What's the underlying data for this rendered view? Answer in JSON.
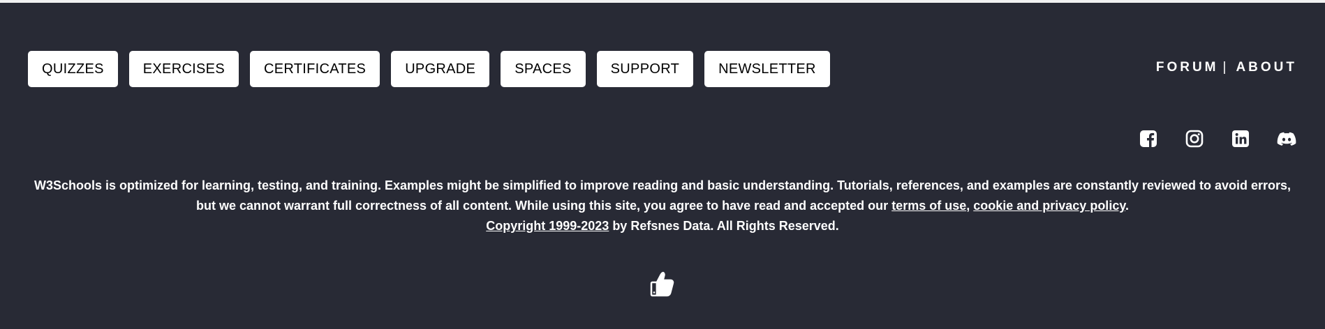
{
  "nav": {
    "buttons": [
      "QUIZZES",
      "EXERCISES",
      "CERTIFICATES",
      "UPGRADE",
      "SPACES",
      "SUPPORT",
      "NEWSLETTER"
    ]
  },
  "top_links": {
    "forum": "FORUM",
    "separator": "|",
    "about": "ABOUT"
  },
  "social": {
    "icons": [
      "facebook-icon",
      "instagram-icon",
      "linkedin-icon",
      "discord-icon"
    ]
  },
  "footer": {
    "text_before_links": "W3Schools is optimized for learning, testing, and training. Examples might be simplified to improve reading and basic understanding. Tutorials, references, and examples are constantly reviewed to avoid errors, but we cannot warrant full correctness of all content. While using this site, you agree to have read and accepted our ",
    "terms_link": "terms of use",
    "comma": ", ",
    "privacy_link": "cookie and privacy policy",
    "period": ".",
    "copyright_link": "Copyright 1999-2023",
    "copyright_rest": " by Refsnes Data. All Rights Reserved."
  },
  "like": {
    "icon": "thumbs-up-icon"
  },
  "colors": {
    "background": "#282a35",
    "button_bg": "#ffffff",
    "button_text": "#000000",
    "text": "#ffffff"
  }
}
